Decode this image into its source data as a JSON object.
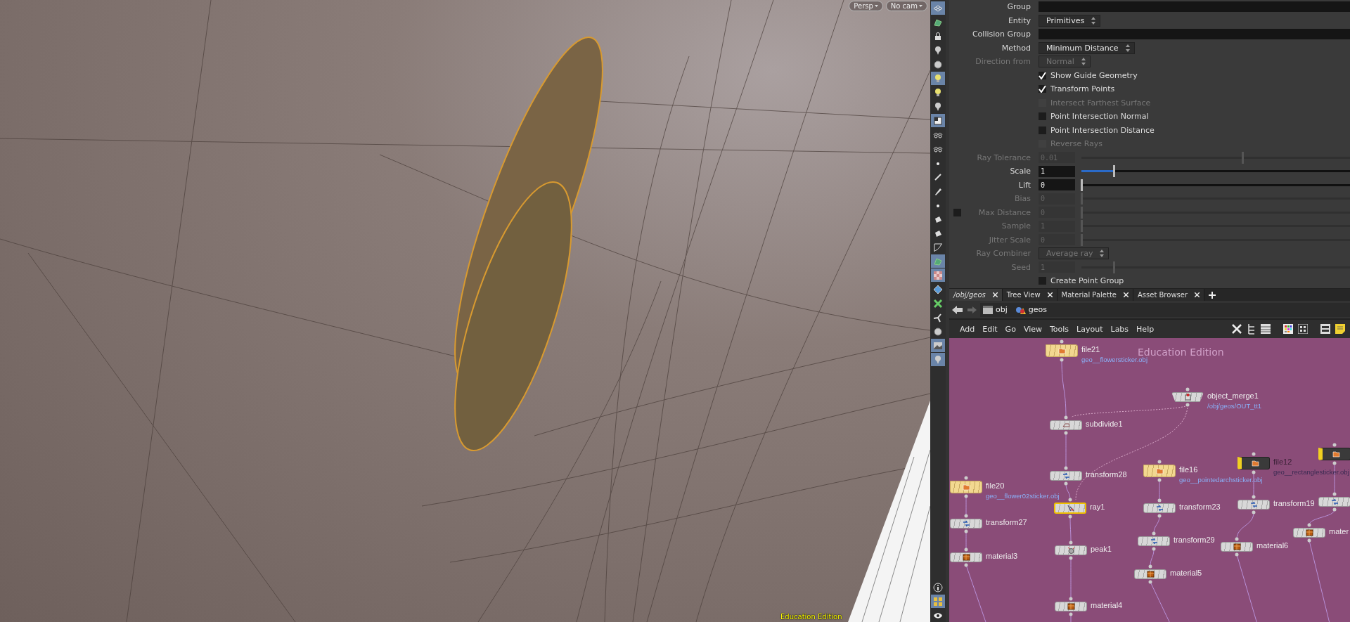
{
  "viewport": {
    "camera_buttons": [
      {
        "label": "Persp"
      },
      {
        "label": "No cam"
      }
    ],
    "edition_label": "Education Edition"
  },
  "tools": [
    {
      "kind": "grid",
      "on": true
    },
    {
      "kind": "shape",
      "on": false
    },
    {
      "kind": "lock",
      "on": false
    },
    {
      "kind": "pin",
      "on": false
    },
    {
      "kind": "circle",
      "on": false
    },
    {
      "kind": "bulb",
      "on": true
    },
    {
      "kind": "bulb",
      "on": false
    },
    {
      "kind": "pin",
      "on": false
    },
    {
      "kind": "cube",
      "on": true
    },
    {
      "kind": "glasses",
      "on": false
    },
    {
      "kind": "glasses",
      "on": false
    },
    {
      "kind": "dot",
      "on": false
    },
    {
      "kind": "brush",
      "on": false
    },
    {
      "kind": "pen",
      "on": false
    },
    {
      "kind": "dot",
      "on": false
    },
    {
      "kind": "bucket",
      "on": false
    },
    {
      "kind": "bucket",
      "on": false
    },
    {
      "kind": "corner",
      "on": false
    },
    {
      "kind": "shape",
      "on": true
    },
    {
      "kind": "checker",
      "on": true
    },
    {
      "kind": "diamond",
      "on": false
    },
    {
      "kind": "star",
      "on": false
    },
    {
      "kind": "fan",
      "on": false
    },
    {
      "kind": "circle",
      "on": false
    },
    {
      "kind": "image",
      "on": true
    },
    {
      "kind": "pin",
      "on": true
    }
  ],
  "bottom_tools": [
    {
      "kind": "info",
      "on": false
    },
    {
      "kind": "grid4",
      "on": true
    },
    {
      "kind": "eye",
      "on": false
    }
  ],
  "parameters": [
    {
      "kind": "field",
      "label": "Group",
      "disabled": false
    },
    {
      "kind": "menu",
      "label": "Entity",
      "value": "Primitives",
      "disabled": false
    },
    {
      "kind": "field",
      "label": "Collision Group",
      "disabled": false
    },
    {
      "kind": "menu",
      "label": "Method",
      "value": "Minimum Distance",
      "disabled": false
    },
    {
      "kind": "menu",
      "label": "Direction from",
      "value": "Normal",
      "disabled": true
    },
    {
      "kind": "toggle",
      "label": "Show Guide Geometry",
      "checked": true,
      "disabled": false
    },
    {
      "kind": "toggle",
      "label": "Transform Points",
      "checked": true,
      "disabled": false
    },
    {
      "kind": "toggle",
      "label": "Intersect Farthest Surface",
      "checked": false,
      "disabled": true
    },
    {
      "kind": "toggle",
      "label": "Point Intersection Normal",
      "checked": false,
      "disabled": false
    },
    {
      "kind": "toggle",
      "label": "Point Intersection Distance",
      "checked": false,
      "disabled": false
    },
    {
      "kind": "toggle",
      "label": "Reverse Rays",
      "checked": false,
      "disabled": true
    },
    {
      "kind": "number",
      "label": "Ray Tolerance",
      "value": "0.01",
      "level": 0.6,
      "disabled": true
    },
    {
      "kind": "number",
      "label": "Scale",
      "value": "1",
      "level": 0.12,
      "disabled": false
    },
    {
      "kind": "number",
      "label": "Lift",
      "value": "0",
      "level": 0,
      "disabled": false
    },
    {
      "kind": "number",
      "label": "Bias",
      "value": "0",
      "level": 0,
      "disabled": true
    },
    {
      "kind": "number",
      "label": "Max Distance",
      "value": "0",
      "level": 0,
      "disabled": true,
      "enable_checked": false
    },
    {
      "kind": "number",
      "label": "Sample",
      "value": "1",
      "level": 0,
      "disabled": true
    },
    {
      "kind": "number",
      "label": "Jitter Scale",
      "value": "0",
      "level": 0,
      "disabled": true
    },
    {
      "kind": "menu",
      "label": "Ray Combiner",
      "value": "Average ray",
      "disabled": true
    },
    {
      "kind": "number",
      "label": "Seed",
      "value": "1",
      "level": 0.12,
      "disabled": true
    },
    {
      "kind": "toggle",
      "label": "Create Point Group",
      "checked": false,
      "disabled": false
    }
  ],
  "tabs": [
    {
      "label": "/obj/geos",
      "selected": true
    },
    {
      "label": "Tree View",
      "selected": false
    },
    {
      "label": "Material Palette",
      "selected": false
    },
    {
      "label": "Asset Browser",
      "selected": false
    }
  ],
  "path": [
    "obj",
    "geos"
  ],
  "menu": [
    "Add",
    "Edit",
    "Go",
    "View",
    "Tools",
    "Layout",
    "Labs",
    "Help"
  ],
  "network": {
    "edition_label": "Education Edition",
    "nodes": [
      {
        "kind": "file",
        "label": "file21",
        "sublabel": "geo__flowersticker.obj",
        "selected": false,
        "bypassed": false
      },
      {
        "kind": "merge",
        "label": "object_merge1",
        "sublabel": "/obj/geos/OUT_tt1",
        "selected": false,
        "bypassed": false
      },
      {
        "kind": "subdivide",
        "label": "subdivide1",
        "selected": false,
        "bypassed": false
      },
      {
        "kind": "transform",
        "label": "transform28",
        "selected": false,
        "bypassed": false
      },
      {
        "kind": "file",
        "label": "file20",
        "sublabel": "geo__flower02sticker.obj",
        "selected": false,
        "bypassed": false
      },
      {
        "kind": "ray",
        "label": "ray1",
        "selected": true,
        "bypassed": false
      },
      {
        "kind": "transform",
        "label": "transform27",
        "selected": false,
        "bypassed": false
      },
      {
        "kind": "material",
        "label": "material3",
        "selected": false,
        "bypassed": false
      },
      {
        "kind": "peak",
        "label": "peak1",
        "selected": false,
        "bypassed": false
      },
      {
        "kind": "material",
        "label": "material4",
        "selected": false,
        "bypassed": false
      },
      {
        "kind": "file",
        "label": "file16",
        "sublabel": "geo__pointedarchsticker.obj",
        "selected": false,
        "bypassed": false
      },
      {
        "kind": "transform",
        "label": "transform23",
        "selected": false,
        "bypassed": false
      },
      {
        "kind": "transform",
        "label": "transform29",
        "selected": false,
        "bypassed": false
      },
      {
        "kind": "material",
        "label": "material5",
        "selected": false,
        "bypassed": false
      },
      {
        "kind": "file",
        "label": "file12",
        "sublabel": "geo__rectanglesticker.obj",
        "selected": false,
        "bypassed": true
      },
      {
        "kind": "transform",
        "label": "transform19",
        "selected": false,
        "bypassed": false
      },
      {
        "kind": "material",
        "label": "material6",
        "selected": false,
        "bypassed": false
      },
      {
        "kind": "file",
        "selected": false,
        "bypassed": true
      },
      {
        "kind": "transform",
        "selected": false,
        "bypassed": false
      },
      {
        "kind": "material",
        "label": "mater",
        "selected": false,
        "bypassed": false
      }
    ]
  }
}
